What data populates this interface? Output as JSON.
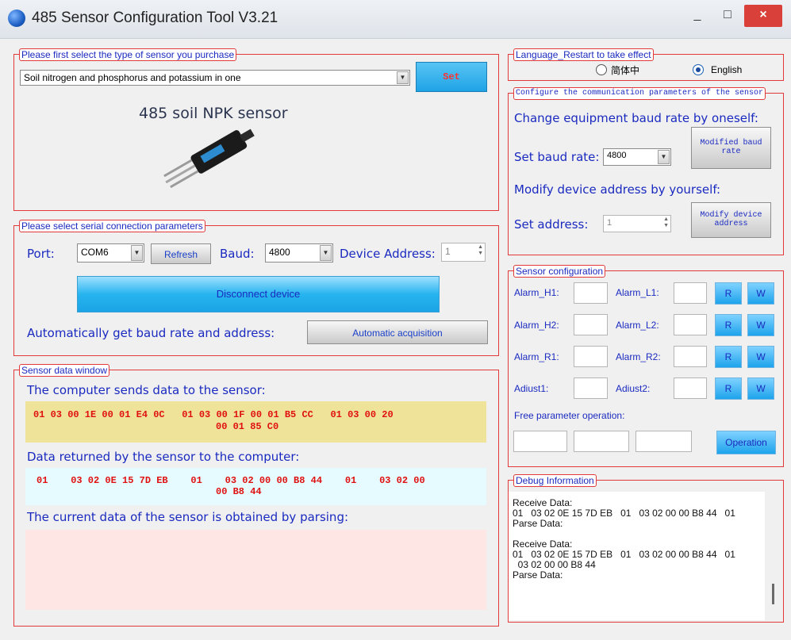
{
  "window": {
    "title": "485 Sensor Configuration Tool V3.21",
    "minimize": "_",
    "maximize": "□",
    "close": "×"
  },
  "sensor_type": {
    "legend": "Please first select the type of sensor you purchase",
    "selected": "Soil nitrogen and phosphorus and potassium in one",
    "set_button": "Set",
    "product_title": "485 soil NPK sensor"
  },
  "serial": {
    "legend": "Please select serial connection parameters",
    "port_label": "Port:",
    "port_value": "COM6",
    "refresh": "Refresh",
    "baud_label": "Baud:",
    "baud_value": "4800",
    "address_label": "Device Address:",
    "address_value": "1",
    "disconnect": "Disconnect device",
    "auto_label": "Automatically get baud rate and address:",
    "auto_button": "Automatic acquisition"
  },
  "data_window": {
    "legend": "Sensor data window",
    "sent_label": "The computer sends data to the sensor:",
    "sent_line1": "01 03 00 1E 00 01 E4 0C   01 03 00 1F 00 01 B5 CC   01 03 00 20",
    "sent_line2": "00 01 85 C0",
    "recv_label": "Data returned by the sensor to the computer:",
    "recv_line1": "01    03 02 0E 15 7D EB    01    03 02 00 00 B8 44    01    03 02 00",
    "recv_line2": "00 B8 44",
    "parse_label": "The current data of the sensor is obtained by parsing:"
  },
  "language": {
    "legend": "Language_Restart to take effect",
    "option_cn": "简体中",
    "option_en": "English",
    "selected": "English"
  },
  "comm": {
    "legend": "Configure the communication parameters of the sensor",
    "baud_heading": "Change equipment baud rate by oneself:",
    "set_baud_label": "Set baud rate:",
    "baud_value": "4800",
    "modify_baud_button": "Modified baud rate",
    "addr_heading": "Modify device address by yourself:",
    "set_addr_label": "Set address:",
    "addr_value": "1",
    "modify_addr_button": "Modify device address"
  },
  "sensor_config": {
    "legend": "Sensor configuration",
    "rows": [
      {
        "left": "Alarm_H1:",
        "right": "Alarm_L1:"
      },
      {
        "left": "Alarm_H2:",
        "right": "Alarm_L2:"
      },
      {
        "left": "Alarm_R1:",
        "right": "Alarm_R2:"
      },
      {
        "left": "Adiust1:",
        "right": "Adiust2:"
      }
    ],
    "read": "R",
    "write": "W",
    "free_label": "Free parameter operation:",
    "operation_button": "Operation"
  },
  "debug": {
    "legend": "Debug Information",
    "lines": "Receive Data:\n01   03 02 0E 15 7D EB   01   03 02 00 00 B8 44   01\nParse Data:\n\nReceive Data:\n01   03 02 0E 15 7D EB   01   03 02 00 00 B8 44   01\n  03 02 00 00 B8 44\nParse Data:"
  },
  "colors": {
    "border": "#e23a3a",
    "legend_text": "#1a2ac0",
    "hex_text": "#e01010",
    "sent_bg": "#efe39a",
    "recv_bg": "#e6fbff",
    "parse_bg": "#fde6e3"
  }
}
